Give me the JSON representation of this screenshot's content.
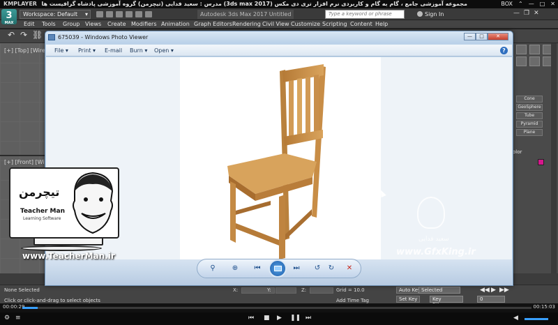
{
  "kmplayer": {
    "logo": "KMPLAYER",
    "title": "مجموعه آموزشی جامع ، گام به گام و کاربردی نرم افزار تری دی مکس (3ds max 2017)   مدرس : سعید فدایی (تیچرمن) گروه آموزشی پادشاه گرافیست ها",
    "controls": [
      "BOX",
      "⌃",
      "—",
      "□",
      "✕"
    ],
    "time_elapsed": "00:00:29",
    "time_total": "00:15:03",
    "progress": 0.03
  },
  "max": {
    "logo": "3",
    "logo_sub": "MAX",
    "workspace": "Workspace: Default",
    "doc_title": "Autodesk 3ds Max 2017  Untitled",
    "search_placeholder": "Type a keyword or phrase",
    "sign_in": "Sign In",
    "menu": [
      "Edit",
      "Tools",
      "Group",
      "Views",
      "Create",
      "Modifiers",
      "Animation",
      "Graph Editors",
      "Rendering",
      "Civil View",
      "Customize",
      "Scripting",
      "Content",
      "Help"
    ],
    "viewport_top_label": "[+] [Top] [Wire]",
    "viewport_bottom_label": "[+] [Front] [Wire]",
    "command_buttons": [
      "Cone",
      "GeoSphere",
      "Tube",
      "Pyramid",
      "Plane"
    ],
    "color_label": "olor",
    "color_swatch": "#d6178c",
    "status_selection": "None Selected",
    "status_prompt": "Click or click-and-drag to select objects",
    "coord_x": "X:",
    "coord_y": "Y:",
    "coord_z": "Z:",
    "grid": "Grid = 10.0",
    "add_time_tag": "Add Time Tag",
    "auto_key": "Auto Key",
    "selected": "Selected",
    "set_key": "Set Key",
    "key_filters": "Key Filters...",
    "frame": "0"
  },
  "photo_viewer": {
    "title": "675039 - Windows Photo Viewer",
    "commands": [
      "File",
      "Print",
      "E-mail",
      "Burn",
      "Open"
    ],
    "help": "?",
    "window_buttons": [
      "—",
      "□",
      "✕"
    ]
  },
  "watermark": {
    "brand": "تیچرمن",
    "teacher_man": "Teacher Man",
    "tagline": "Learning Software",
    "url": "www.TeacherMan.ir",
    "gfx_name": "سعید فدایی",
    "gfx_url": "www.GfxKing.ir"
  }
}
